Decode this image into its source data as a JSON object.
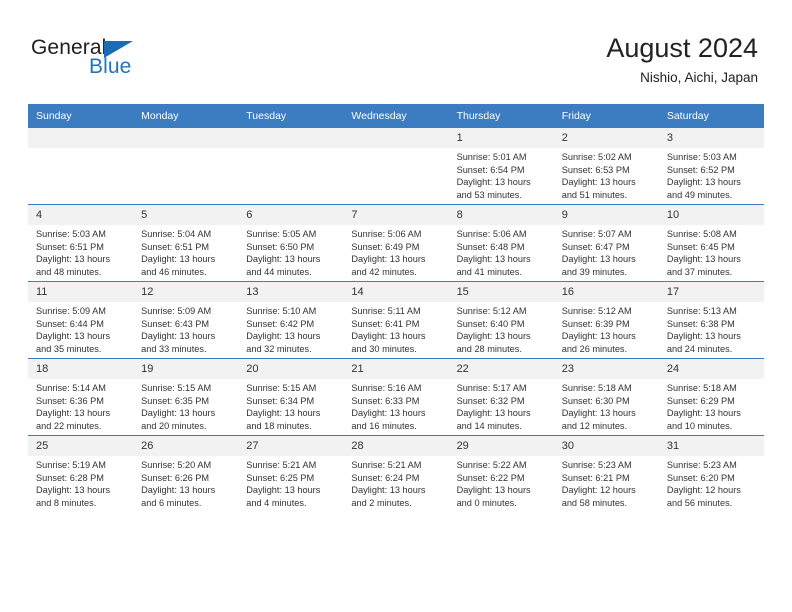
{
  "brand": {
    "name_top": "General",
    "name_bottom": "Blue",
    "triangle_color": "#1b6cb5",
    "blue_color": "#2176bd"
  },
  "header": {
    "title": "August 2024",
    "subtitle": "Nishio, Aichi, Japan"
  },
  "theme": {
    "header_row_bg": "#3b7dc0",
    "header_row_text": "#ffffff",
    "daynum_bg": "#f2f2f2",
    "cell_border": "#3b7dc0",
    "body_text": "#333333"
  },
  "weekday_headers": [
    "Sunday",
    "Monday",
    "Tuesday",
    "Wednesday",
    "Thursday",
    "Friday",
    "Saturday"
  ],
  "labels": {
    "sunrise_prefix": "Sunrise:",
    "sunset_prefix": "Sunset:",
    "daylight_prefix": "Daylight:"
  },
  "weeks": [
    [
      {
        "day": "",
        "empty": true,
        "sunrise": "",
        "sunset": "",
        "daylight_line1": "",
        "daylight_line2": ""
      },
      {
        "day": "",
        "empty": true,
        "sunrise": "",
        "sunset": "",
        "daylight_line1": "",
        "daylight_line2": ""
      },
      {
        "day": "",
        "empty": true,
        "sunrise": "",
        "sunset": "",
        "daylight_line1": "",
        "daylight_line2": ""
      },
      {
        "day": "",
        "empty": true,
        "sunrise": "",
        "sunset": "",
        "daylight_line1": "",
        "daylight_line2": ""
      },
      {
        "day": "1",
        "empty": false,
        "sunrise": "Sunrise: 5:01 AM",
        "sunset": "Sunset: 6:54 PM",
        "daylight_line1": "Daylight: 13 hours",
        "daylight_line2": "and 53 minutes."
      },
      {
        "day": "2",
        "empty": false,
        "sunrise": "Sunrise: 5:02 AM",
        "sunset": "Sunset: 6:53 PM",
        "daylight_line1": "Daylight: 13 hours",
        "daylight_line2": "and 51 minutes."
      },
      {
        "day": "3",
        "empty": false,
        "sunrise": "Sunrise: 5:03 AM",
        "sunset": "Sunset: 6:52 PM",
        "daylight_line1": "Daylight: 13 hours",
        "daylight_line2": "and 49 minutes."
      }
    ],
    [
      {
        "day": "4",
        "empty": false,
        "sunrise": "Sunrise: 5:03 AM",
        "sunset": "Sunset: 6:51 PM",
        "daylight_line1": "Daylight: 13 hours",
        "daylight_line2": "and 48 minutes."
      },
      {
        "day": "5",
        "empty": false,
        "sunrise": "Sunrise: 5:04 AM",
        "sunset": "Sunset: 6:51 PM",
        "daylight_line1": "Daylight: 13 hours",
        "daylight_line2": "and 46 minutes."
      },
      {
        "day": "6",
        "empty": false,
        "sunrise": "Sunrise: 5:05 AM",
        "sunset": "Sunset: 6:50 PM",
        "daylight_line1": "Daylight: 13 hours",
        "daylight_line2": "and 44 minutes."
      },
      {
        "day": "7",
        "empty": false,
        "sunrise": "Sunrise: 5:06 AM",
        "sunset": "Sunset: 6:49 PM",
        "daylight_line1": "Daylight: 13 hours",
        "daylight_line2": "and 42 minutes."
      },
      {
        "day": "8",
        "empty": false,
        "sunrise": "Sunrise: 5:06 AM",
        "sunset": "Sunset: 6:48 PM",
        "daylight_line1": "Daylight: 13 hours",
        "daylight_line2": "and 41 minutes."
      },
      {
        "day": "9",
        "empty": false,
        "sunrise": "Sunrise: 5:07 AM",
        "sunset": "Sunset: 6:47 PM",
        "daylight_line1": "Daylight: 13 hours",
        "daylight_line2": "and 39 minutes."
      },
      {
        "day": "10",
        "empty": false,
        "sunrise": "Sunrise: 5:08 AM",
        "sunset": "Sunset: 6:45 PM",
        "daylight_line1": "Daylight: 13 hours",
        "daylight_line2": "and 37 minutes."
      }
    ],
    [
      {
        "day": "11",
        "empty": false,
        "sunrise": "Sunrise: 5:09 AM",
        "sunset": "Sunset: 6:44 PM",
        "daylight_line1": "Daylight: 13 hours",
        "daylight_line2": "and 35 minutes."
      },
      {
        "day": "12",
        "empty": false,
        "sunrise": "Sunrise: 5:09 AM",
        "sunset": "Sunset: 6:43 PM",
        "daylight_line1": "Daylight: 13 hours",
        "daylight_line2": "and 33 minutes."
      },
      {
        "day": "13",
        "empty": false,
        "sunrise": "Sunrise: 5:10 AM",
        "sunset": "Sunset: 6:42 PM",
        "daylight_line1": "Daylight: 13 hours",
        "daylight_line2": "and 32 minutes."
      },
      {
        "day": "14",
        "empty": false,
        "sunrise": "Sunrise: 5:11 AM",
        "sunset": "Sunset: 6:41 PM",
        "daylight_line1": "Daylight: 13 hours",
        "daylight_line2": "and 30 minutes."
      },
      {
        "day": "15",
        "empty": false,
        "sunrise": "Sunrise: 5:12 AM",
        "sunset": "Sunset: 6:40 PM",
        "daylight_line1": "Daylight: 13 hours",
        "daylight_line2": "and 28 minutes."
      },
      {
        "day": "16",
        "empty": false,
        "sunrise": "Sunrise: 5:12 AM",
        "sunset": "Sunset: 6:39 PM",
        "daylight_line1": "Daylight: 13 hours",
        "daylight_line2": "and 26 minutes."
      },
      {
        "day": "17",
        "empty": false,
        "sunrise": "Sunrise: 5:13 AM",
        "sunset": "Sunset: 6:38 PM",
        "daylight_line1": "Daylight: 13 hours",
        "daylight_line2": "and 24 minutes."
      }
    ],
    [
      {
        "day": "18",
        "empty": false,
        "sunrise": "Sunrise: 5:14 AM",
        "sunset": "Sunset: 6:36 PM",
        "daylight_line1": "Daylight: 13 hours",
        "daylight_line2": "and 22 minutes."
      },
      {
        "day": "19",
        "empty": false,
        "sunrise": "Sunrise: 5:15 AM",
        "sunset": "Sunset: 6:35 PM",
        "daylight_line1": "Daylight: 13 hours",
        "daylight_line2": "and 20 minutes."
      },
      {
        "day": "20",
        "empty": false,
        "sunrise": "Sunrise: 5:15 AM",
        "sunset": "Sunset: 6:34 PM",
        "daylight_line1": "Daylight: 13 hours",
        "daylight_line2": "and 18 minutes."
      },
      {
        "day": "21",
        "empty": false,
        "sunrise": "Sunrise: 5:16 AM",
        "sunset": "Sunset: 6:33 PM",
        "daylight_line1": "Daylight: 13 hours",
        "daylight_line2": "and 16 minutes."
      },
      {
        "day": "22",
        "empty": false,
        "sunrise": "Sunrise: 5:17 AM",
        "sunset": "Sunset: 6:32 PM",
        "daylight_line1": "Daylight: 13 hours",
        "daylight_line2": "and 14 minutes."
      },
      {
        "day": "23",
        "empty": false,
        "sunrise": "Sunrise: 5:18 AM",
        "sunset": "Sunset: 6:30 PM",
        "daylight_line1": "Daylight: 13 hours",
        "daylight_line2": "and 12 minutes."
      },
      {
        "day": "24",
        "empty": false,
        "sunrise": "Sunrise: 5:18 AM",
        "sunset": "Sunset: 6:29 PM",
        "daylight_line1": "Daylight: 13 hours",
        "daylight_line2": "and 10 minutes."
      }
    ],
    [
      {
        "day": "25",
        "empty": false,
        "sunrise": "Sunrise: 5:19 AM",
        "sunset": "Sunset: 6:28 PM",
        "daylight_line1": "Daylight: 13 hours",
        "daylight_line2": "and 8 minutes."
      },
      {
        "day": "26",
        "empty": false,
        "sunrise": "Sunrise: 5:20 AM",
        "sunset": "Sunset: 6:26 PM",
        "daylight_line1": "Daylight: 13 hours",
        "daylight_line2": "and 6 minutes."
      },
      {
        "day": "27",
        "empty": false,
        "sunrise": "Sunrise: 5:21 AM",
        "sunset": "Sunset: 6:25 PM",
        "daylight_line1": "Daylight: 13 hours",
        "daylight_line2": "and 4 minutes."
      },
      {
        "day": "28",
        "empty": false,
        "sunrise": "Sunrise: 5:21 AM",
        "sunset": "Sunset: 6:24 PM",
        "daylight_line1": "Daylight: 13 hours",
        "daylight_line2": "and 2 minutes."
      },
      {
        "day": "29",
        "empty": false,
        "sunrise": "Sunrise: 5:22 AM",
        "sunset": "Sunset: 6:22 PM",
        "daylight_line1": "Daylight: 13 hours",
        "daylight_line2": "and 0 minutes."
      },
      {
        "day": "30",
        "empty": false,
        "sunrise": "Sunrise: 5:23 AM",
        "sunset": "Sunset: 6:21 PM",
        "daylight_line1": "Daylight: 12 hours",
        "daylight_line2": "and 58 minutes."
      },
      {
        "day": "31",
        "empty": false,
        "sunrise": "Sunrise: 5:23 AM",
        "sunset": "Sunset: 6:20 PM",
        "daylight_line1": "Daylight: 12 hours",
        "daylight_line2": "and 56 minutes."
      }
    ]
  ]
}
